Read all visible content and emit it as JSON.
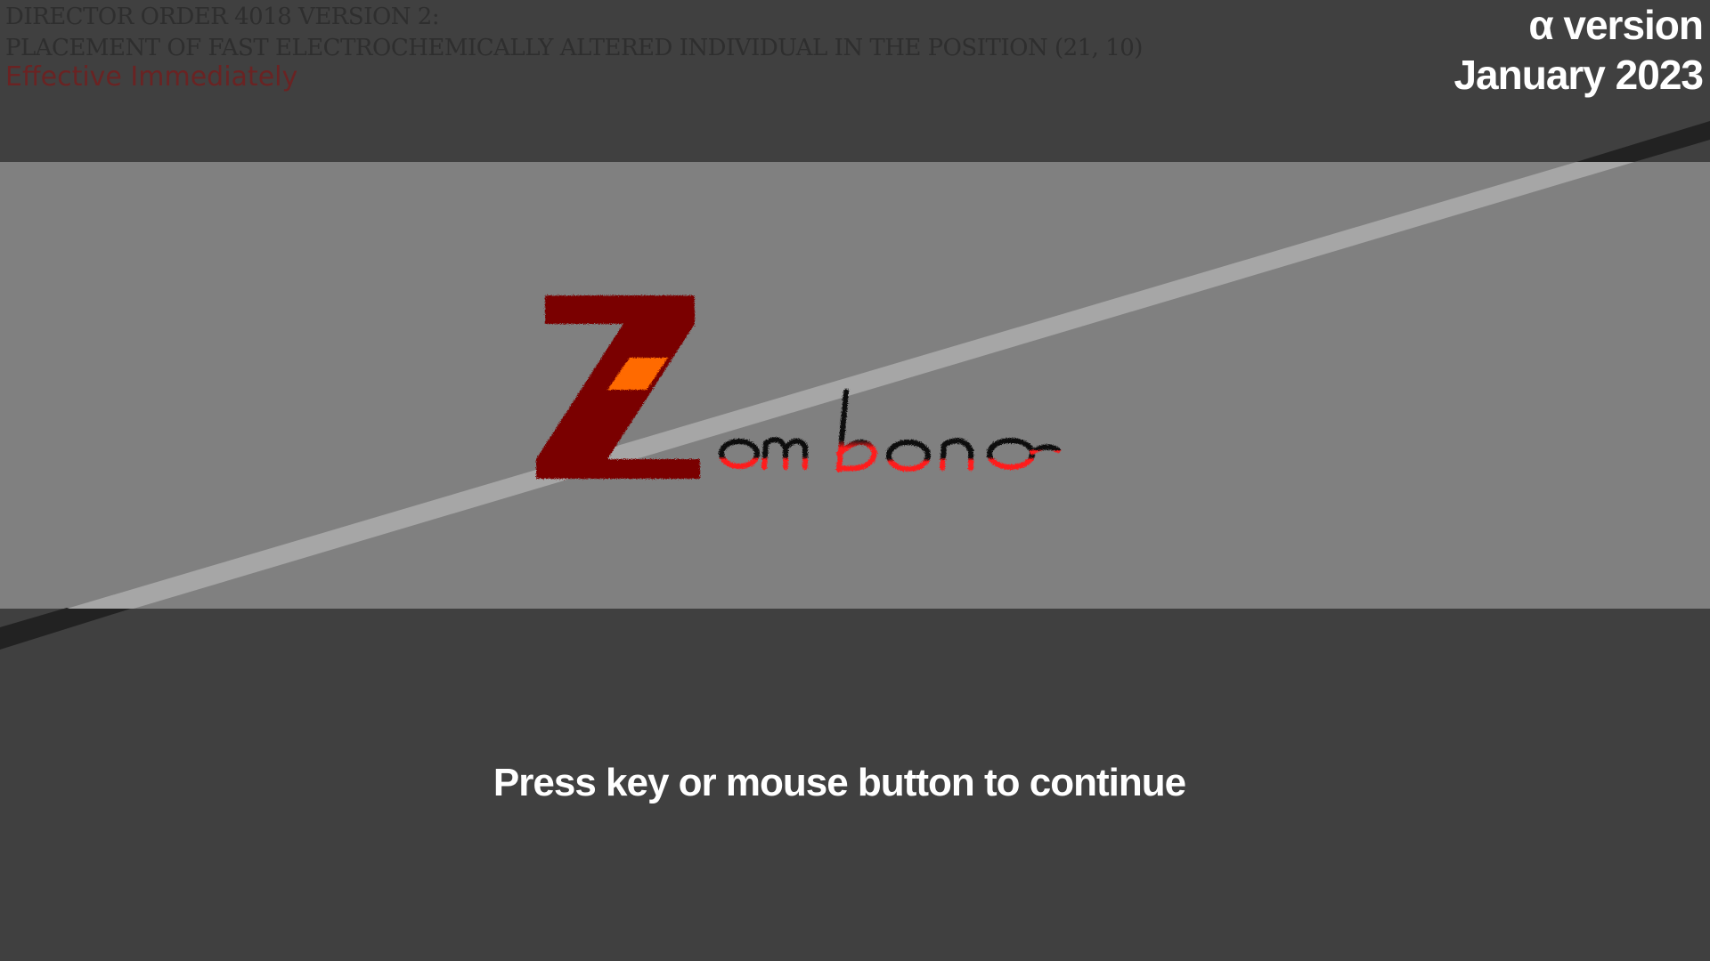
{
  "directive": {
    "line1": "DIRECTOR ORDER 4018 VERSION 2:",
    "line2": "PLACEMENT OF FAST ELECTROCHEMICALLY ALTERED INDIVIDUAL IN THE POSITION (21, 10)",
    "effective": "Effective Immediately"
  },
  "version": {
    "label": "α version",
    "date": "January 2023"
  },
  "logo": {
    "initial": "Z",
    "rest": "ombono",
    "colors": {
      "initial": "#7a0000",
      "initial_accent": "#ff6a00",
      "rest_top": "#111111",
      "rest_bottom": "#ff1a1a"
    }
  },
  "prompt": {
    "text": "Press key or mouse button to continue"
  },
  "colors": {
    "background": "#404040",
    "banner": "#808080",
    "stripe_light": "#a6a6a6",
    "stripe_dark": "#222222",
    "effective_text": "#6a2323"
  }
}
